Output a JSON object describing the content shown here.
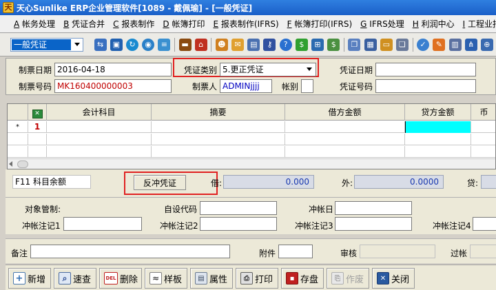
{
  "window": {
    "title": "天心Sunlike ERP企业管理软件[1089 - 戴佩瑜] - [一般凭证]"
  },
  "menu": [
    {
      "key": "A",
      "label": "帐务处理"
    },
    {
      "key": "B",
      "label": "凭证合并"
    },
    {
      "key": "C",
      "label": "报表制作"
    },
    {
      "key": "D",
      "label": "帐簿打印"
    },
    {
      "key": "E",
      "label": "报表制作(IFRS)"
    },
    {
      "key": "F",
      "label": "帐簿打印(IFRS)"
    },
    {
      "key": "G",
      "label": "IFRS处理"
    },
    {
      "key": "H",
      "label": "利润中心"
    },
    {
      "key": "I",
      "label": "工程业报表"
    }
  ],
  "toolbar": {
    "voucher_type_selected": "一般凭证"
  },
  "header": {
    "date_label": "制票日期",
    "date_value": "2016-04-18",
    "number_label": "制票号码",
    "number_value": "MK160400000003",
    "voucher_class_label": "凭证类别",
    "voucher_class_value": "5.更正凭证",
    "maker_label": "制票人",
    "maker_value": "ADMINjjjj",
    "book_label": "帐别",
    "book_value": "",
    "voucher_date_label": "凭证日期",
    "voucher_date_value": "",
    "voucher_no_label": "凭证号码",
    "voucher_no_value": ""
  },
  "grid": {
    "columns": [
      "会计科目",
      "摘要",
      "借方金额",
      "贷方金额",
      "币"
    ],
    "rows": [
      {
        "marker": "*",
        "num": "1",
        "account": "",
        "summary": "",
        "debit": "",
        "credit": ""
      }
    ]
  },
  "summary": {
    "f11_label": "F11 科目余额",
    "reverse_button": "反冲凭证",
    "debit_label": "借:",
    "debit_value": "0.000",
    "foreign_label": "外:",
    "foreign_value": "0.0000",
    "credit_label": "贷:"
  },
  "detail": {
    "object_label": "对象管制:",
    "custom_code_label": "自设代码",
    "offset_date_label": "冲帐日",
    "note1_label": "冲帐注记1",
    "note2_label": "冲帐注记2",
    "note3_label": "冲帐注记3",
    "note4_label": "冲帐注记4"
  },
  "footer": {
    "remark_label": "备注",
    "attach_label": "附件",
    "audit_label": "审核",
    "post_label": "过帐"
  },
  "buttons": {
    "add": "新增",
    "query": "速查",
    "delete": "删除",
    "del_tag": "DEL",
    "template": "样板",
    "properties": "属性",
    "print": "打印",
    "save": "存盘",
    "void": "作废",
    "close": "关闭"
  }
}
